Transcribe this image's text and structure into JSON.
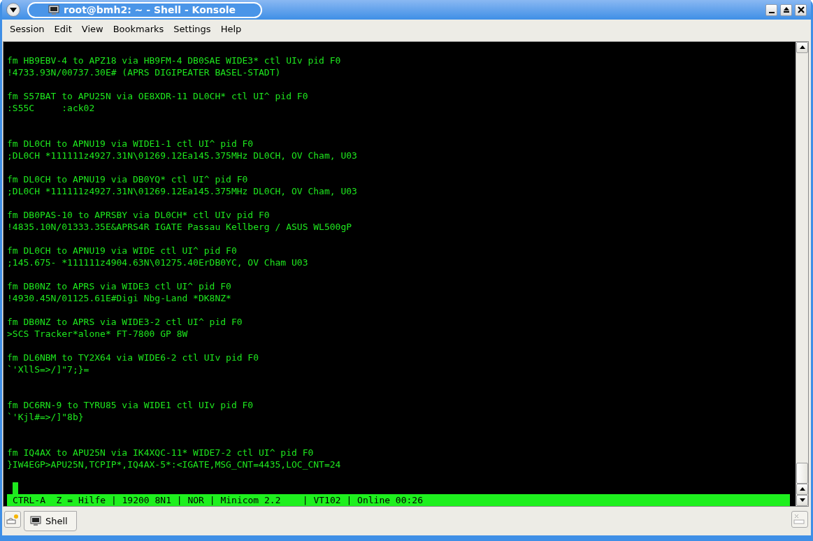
{
  "window": {
    "title": "root@bmh2: ~ - Shell - Konsole"
  },
  "menu": [
    "Session",
    "Edit",
    "View",
    "Bookmarks",
    "Settings",
    "Help"
  ],
  "terminal": {
    "lines": [
      {
        "kind": "blank"
      },
      {
        "kind": "text",
        "text": "fm HB9EBV-4 to APZ18 via HB9FM-4 DB0SAE WIDE3* ctl UIv pid F0"
      },
      {
        "kind": "text",
        "text": "!4733.93N/00737.30E# (APRS DIGIPEATER BASEL-STADT)"
      },
      {
        "kind": "blank"
      },
      {
        "kind": "text",
        "text": "fm S57BAT to APU25N via OE8XDR-11 DL0CH* ctl UI^ pid F0"
      },
      {
        "kind": "text",
        "text": ":S55C     :ack02"
      },
      {
        "kind": "blank"
      },
      {
        "kind": "blank"
      },
      {
        "kind": "text",
        "text": "fm DL0CH to APNU19 via WIDE1-1 ctl UI^ pid F0"
      },
      {
        "kind": "text",
        "text": ";DL0CH *111111z4927.31N\\01269.12Ea145.375MHz DL0CH, OV Cham, U03"
      },
      {
        "kind": "blank"
      },
      {
        "kind": "text",
        "text": "fm DL0CH to APNU19 via DB0YQ* ctl UI^ pid F0"
      },
      {
        "kind": "text",
        "text": ";DL0CH *111111z4927.31N\\01269.12Ea145.375MHz DL0CH, OV Cham, U03"
      },
      {
        "kind": "blank"
      },
      {
        "kind": "text",
        "text": "fm DB0PAS-10 to APRSBY via DL0CH* ctl UIv pid F0"
      },
      {
        "kind": "text",
        "text": "!4835.10N/01333.35E&APRS4R IGATE Passau Kellberg / ASUS WL500gP"
      },
      {
        "kind": "blank"
      },
      {
        "kind": "text",
        "text": "fm DL0CH to APNU19 via WIDE ctl UI^ pid F0"
      },
      {
        "kind": "text",
        "text": ";145.675- *111111z4904.63N\\01275.40ErDB0YC, OV Cham U03"
      },
      {
        "kind": "blank"
      },
      {
        "kind": "text",
        "text": "fm DB0NZ to APRS via WIDE3 ctl UI^ pid F0"
      },
      {
        "kind": "text",
        "text": "!4930.45N/01125.61E#Digi Nbg-Land *DK8NZ*"
      },
      {
        "kind": "blank"
      },
      {
        "kind": "text",
        "text": "fm DB0NZ to APRS via WIDE3-2 ctl UI^ pid F0"
      },
      {
        "kind": "text",
        "text": ">SCS Tracker*alone* FT-7800 GP 8W"
      },
      {
        "kind": "blank"
      },
      {
        "kind": "text",
        "text": "fm DL6NBM to TY2X64 via WIDE6-2 ctl UIv pid F0"
      },
      {
        "kind": "text",
        "text": "`'XllS=>/]\"7;}="
      },
      {
        "kind": "blank"
      },
      {
        "kind": "blank"
      },
      {
        "kind": "text",
        "text": "fm DC6RN-9 to TYRU85 via WIDE1 ctl UIv pid F0"
      },
      {
        "kind": "text",
        "text": "`'Kjl#=>/]\"8b}"
      },
      {
        "kind": "blank"
      },
      {
        "kind": "blank"
      },
      {
        "kind": "text",
        "text": "fm IQ4AX to APU25N via IK4XQC-11* WIDE7-2 ctl UI^ pid F0"
      },
      {
        "kind": "text",
        "text": "}IW4EGP>APU25N,TCPIP*,IQ4AX-5*:<IGATE,MSG_CNT=4435,LOC_CNT=24"
      },
      {
        "kind": "blank"
      },
      {
        "kind": "cursor"
      }
    ],
    "status": "CTRL-A  Z = Hilfe | 19200 8N1 | NOR | Minicom 2.2    | VT102 | Online 00:26"
  },
  "tabs": [
    {
      "label": "Shell",
      "selected": true
    }
  ]
}
